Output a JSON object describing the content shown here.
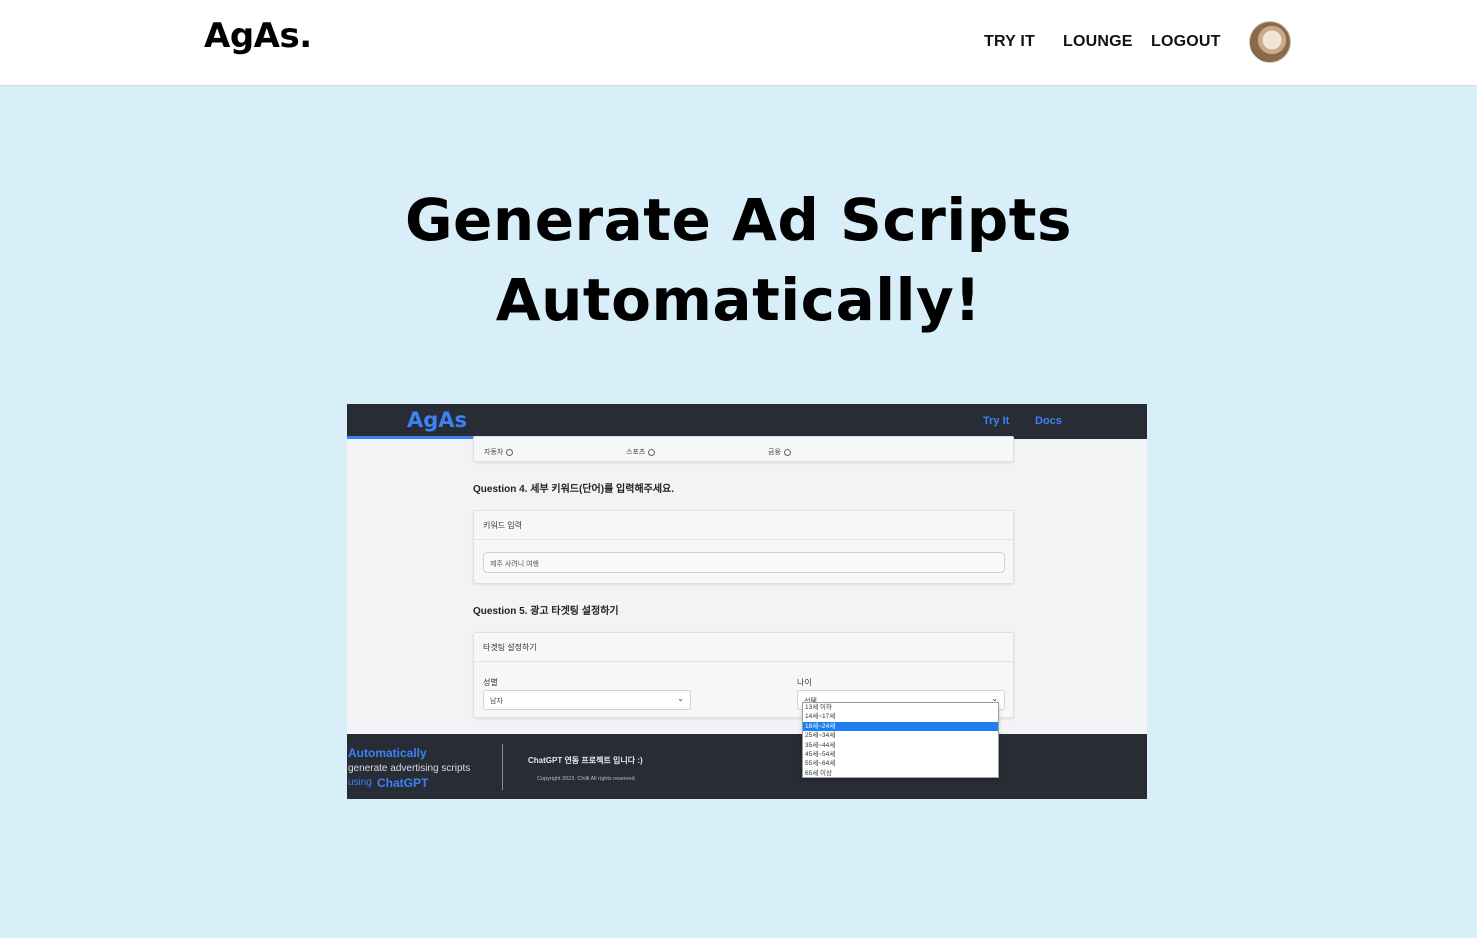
{
  "header": {
    "logo": "AgAs.",
    "nav": {
      "try_it": "TRY IT",
      "lounge": "LOUNGE",
      "logout": "LOGOUT"
    }
  },
  "hero": {
    "line1": "Generate Ad Scripts",
    "line2": "Automatically!"
  },
  "preview": {
    "header": {
      "logo": "AgAs",
      "try_it": "Try It",
      "docs": "Docs"
    },
    "options_row": [
      "자동차",
      "스포츠",
      "금융"
    ],
    "q4": {
      "label": "Question 4. 세부 키워드(단어)를 입력해주세요.",
      "card_title": "키워드 입력",
      "input_value": "제주 사려니 여행"
    },
    "q5": {
      "label": "Question 5. 광고 타겟팅 설정하기",
      "card_title": "타겟팅 설정하기",
      "gender_label": "성별",
      "gender_value": "남자",
      "age_label": "나이",
      "age_value": "선택",
      "age_options": [
        "13세 이하",
        "14세~17세",
        "18세~24세",
        "25세~34세",
        "35세~44세",
        "45세~54세",
        "55세~64세",
        "65세 이상"
      ],
      "age_selected_index": 2
    },
    "footer": {
      "line1": "Automatically",
      "line2": "generate advertising scripts",
      "line3_prefix": "using",
      "line3_brand": "ChatGPT",
      "project": "ChatGPT 연동 프로젝트 입니다 :)",
      "copyright": "Copyright 2023. Chilli All rights reserved."
    }
  },
  "colors": {
    "page_background": "#d8eef8",
    "header_background": "#ffffff",
    "preview_dark": "#282c34",
    "accent_blue": "#3b82f6",
    "dropdown_selected": "#1e7ff0"
  }
}
